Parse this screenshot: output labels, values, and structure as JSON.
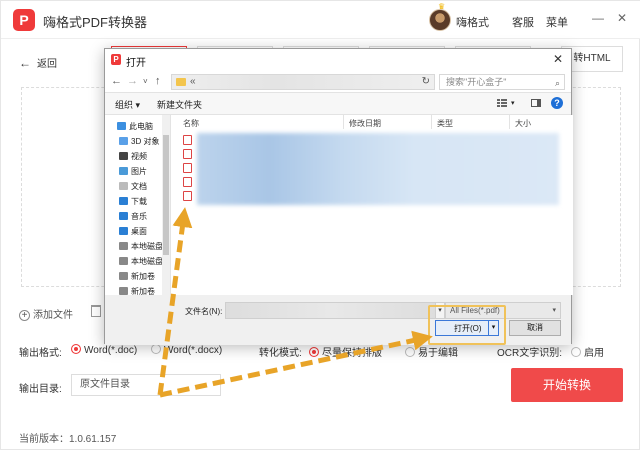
{
  "app": {
    "title": "嗨格式PDF转换器",
    "logo_text": "P",
    "username": "嗨格式",
    "support_label": "客服",
    "menu_label": "菜单",
    "minimize_glyph": "—",
    "close_glyph": "✕",
    "back_label": "返回",
    "tab_visible_label": "转HTML",
    "add_file_label": "添加文件",
    "output_format_label": "输出格式:",
    "format_options": [
      "Word(*.doc)",
      "Word(*.docx)"
    ],
    "conversion_mode_label": "转化模式:",
    "mode_options": [
      "尽量保持排版",
      "易于编辑"
    ],
    "ocr_label": "OCR文字识别:",
    "ocr_option": "启用",
    "output_dir_label": "输出目录:",
    "output_dir_value": "原文件目录",
    "start_button_label": "开始转换",
    "version_text": "当前版本：1.0.61.157",
    "accent_color": "#f04a4a"
  },
  "dialog": {
    "title": "打开",
    "address_separator": "«",
    "search_placeholder": "搜索\"开心盒子\"",
    "organize_label": "组织 ▾",
    "new_folder_label": "新建文件夹",
    "nav_items": [
      {
        "label": "此电脑",
        "icon": "computer-icon"
      },
      {
        "label": "3D 对象",
        "icon": "cube-icon"
      },
      {
        "label": "视频",
        "icon": "video-icon"
      },
      {
        "label": "图片",
        "icon": "picture-icon"
      },
      {
        "label": "文档",
        "icon": "document-icon"
      },
      {
        "label": "下载",
        "icon": "download-icon"
      },
      {
        "label": "音乐",
        "icon": "music-icon"
      },
      {
        "label": "桌面",
        "icon": "desktop-icon"
      },
      {
        "label": "本地磁盘",
        "icon": "drive-icon"
      },
      {
        "label": "本地磁盘",
        "icon": "drive-icon"
      },
      {
        "label": "新加卷",
        "icon": "drive-icon"
      },
      {
        "label": "新加卷",
        "icon": "drive-icon"
      }
    ],
    "columns": [
      "名称",
      "修改日期",
      "类型",
      "大小"
    ],
    "filename_label": "文件名(N):",
    "filter_value": "All Files(*.pdf)",
    "open_button_label": "打开(O)",
    "cancel_button_label": "取消"
  }
}
